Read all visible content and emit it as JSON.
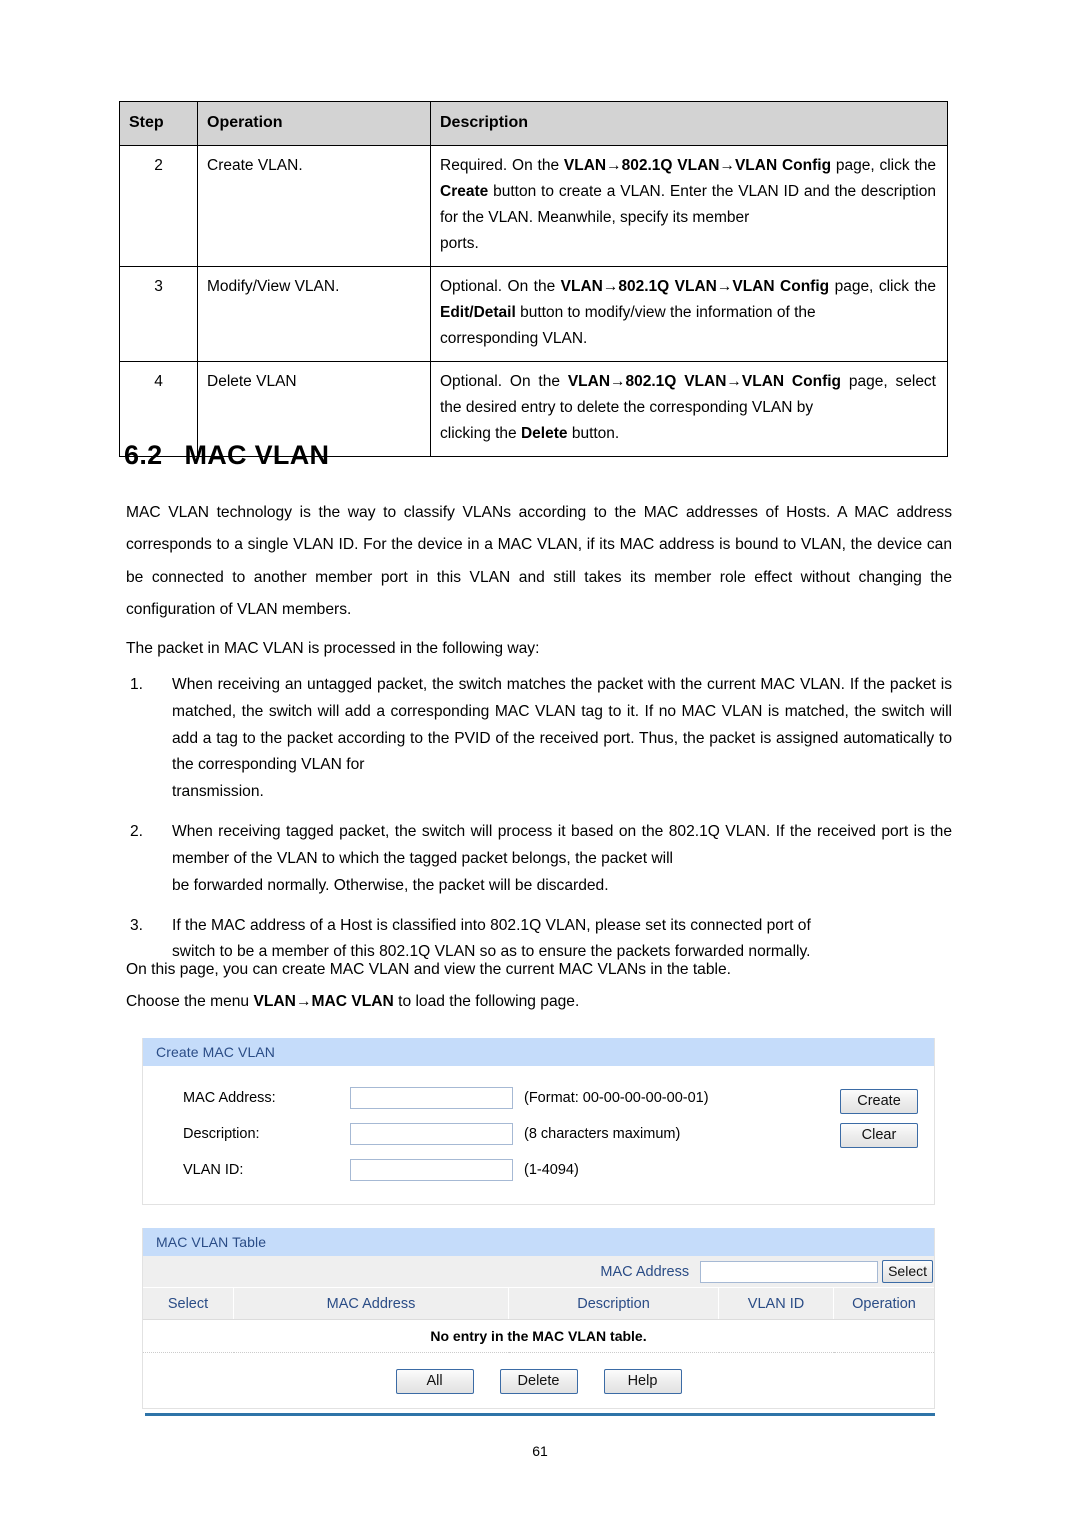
{
  "steps_table": {
    "headers": [
      "Step",
      "Operation",
      "Description"
    ],
    "rows": [
      {
        "step": "2",
        "operation": "Create VLAN.",
        "description_parts": [
          {
            "t": "Required. On the ",
            "bold": false
          },
          {
            "t": "VLAN→802.1Q VLAN→VLAN Config",
            "bold": true
          },
          {
            "t": " page, click the ",
            "bold": false
          },
          {
            "t": "Create",
            "bold": true
          },
          {
            "t": " button to create a VLAN. Enter the VLAN ID and the description for the VLAN. Meanwhile, specify its member",
            "bold": false
          }
        ],
        "description_last": "ports."
      },
      {
        "step": "3",
        "operation": "Modify/View VLAN.",
        "description_parts": [
          {
            "t": "Optional. On the ",
            "bold": false
          },
          {
            "t": "VLAN→802.1Q VLAN→VLAN Config",
            "bold": true
          },
          {
            "t": " page, click the ",
            "bold": false
          },
          {
            "t": "Edit/Detail",
            "bold": true
          },
          {
            "t": " button to modify/view the information of the",
            "bold": false
          }
        ],
        "description_last": "corresponding VLAN."
      },
      {
        "step": "4",
        "operation": "Delete VLAN",
        "description_parts": [
          {
            "t": "Optional. On the ",
            "bold": false
          },
          {
            "t": "VLAN→802.1Q VLAN→VLAN Config",
            "bold": true
          },
          {
            "t": " page, select the desired entry to delete the corresponding VLAN by",
            "bold": false
          }
        ],
        "description_last_parts": [
          {
            "t": "clicking the ",
            "bold": false
          },
          {
            "t": "Delete",
            "bold": true
          },
          {
            "t": " button.",
            "bold": false
          }
        ]
      }
    ]
  },
  "heading": {
    "number": "6.2",
    "title": "MAC VLAN"
  },
  "paragraphs": {
    "intro": "MAC VLAN technology is the way to classify VLANs according to the MAC addresses of Hosts. A MAC address corresponds to a single VLAN ID. For the device in a MAC VLAN, if its MAC address is bound to VLAN, the device can be connected to another member port in this VLAN and still takes its member role effect without changing the configuration of VLAN members.",
    "processed_way": "The packet in MAC VLAN is processed in the following way:",
    "on_this_page": "On this page, you can create MAC VLAN and view the current MAC VLANs in the table.",
    "choose_menu_pre": "Choose the menu ",
    "choose_menu_bold": "VLAN→MAC VLAN",
    "choose_menu_post": " to load the following page."
  },
  "numbered_list": [
    {
      "marker": "1.",
      "text": "When receiving an untagged packet, the switch matches the packet with the current MAC VLAN. If the packet is matched, the switch will add a corresponding MAC VLAN tag to it. If no MAC VLAN is matched, the switch will add a tag to the packet according to the PVID of the received port. Thus, the packet is assigned automatically to the corresponding VLAN for",
      "last": "transmission."
    },
    {
      "marker": "2.",
      "text": "When receiving tagged packet, the switch will process it based on the 802.1Q VLAN. If the received port is the member of the VLAN to which the tagged packet belongs, the packet will",
      "last": "be forwarded normally. Otherwise, the packet will be discarded."
    },
    {
      "marker": "3.",
      "text": "If the MAC address of a Host is classified into 802.1Q VLAN, please set its connected port of",
      "last": "switch to be a member of this 802.1Q VLAN so as to ensure the packets forwarded normally."
    }
  ],
  "ui": {
    "create_panel": {
      "title": "Create MAC VLAN",
      "fields": [
        {
          "label": "MAC Address:",
          "value": "",
          "hint": "(Format: 00-00-00-00-00-01)"
        },
        {
          "label": "Description:",
          "value": "",
          "hint": "(8 characters maximum)"
        },
        {
          "label": "VLAN ID:",
          "value": "",
          "hint": "(1-4094)"
        }
      ],
      "buttons": {
        "create": "Create",
        "clear": "Clear"
      }
    },
    "table_panel": {
      "title": "MAC VLAN Table",
      "search": {
        "label": "MAC Address",
        "value": "",
        "button": "Select"
      },
      "headers": [
        "Select",
        "MAC Address",
        "Description",
        "VLAN ID",
        "Operation"
      ],
      "empty_message": "No entry in the MAC VLAN table.",
      "buttons": [
        "All",
        "Delete",
        "Help"
      ]
    },
    "colors": {
      "panel_header_bg": "#c5dcfa",
      "panel_header_text": "#2a4c86",
      "table_header_bg": "#efefef",
      "button_border": "#3b6ba5",
      "footer_rule": "#2e74a8"
    }
  },
  "footer": {
    "page_number": "61"
  }
}
